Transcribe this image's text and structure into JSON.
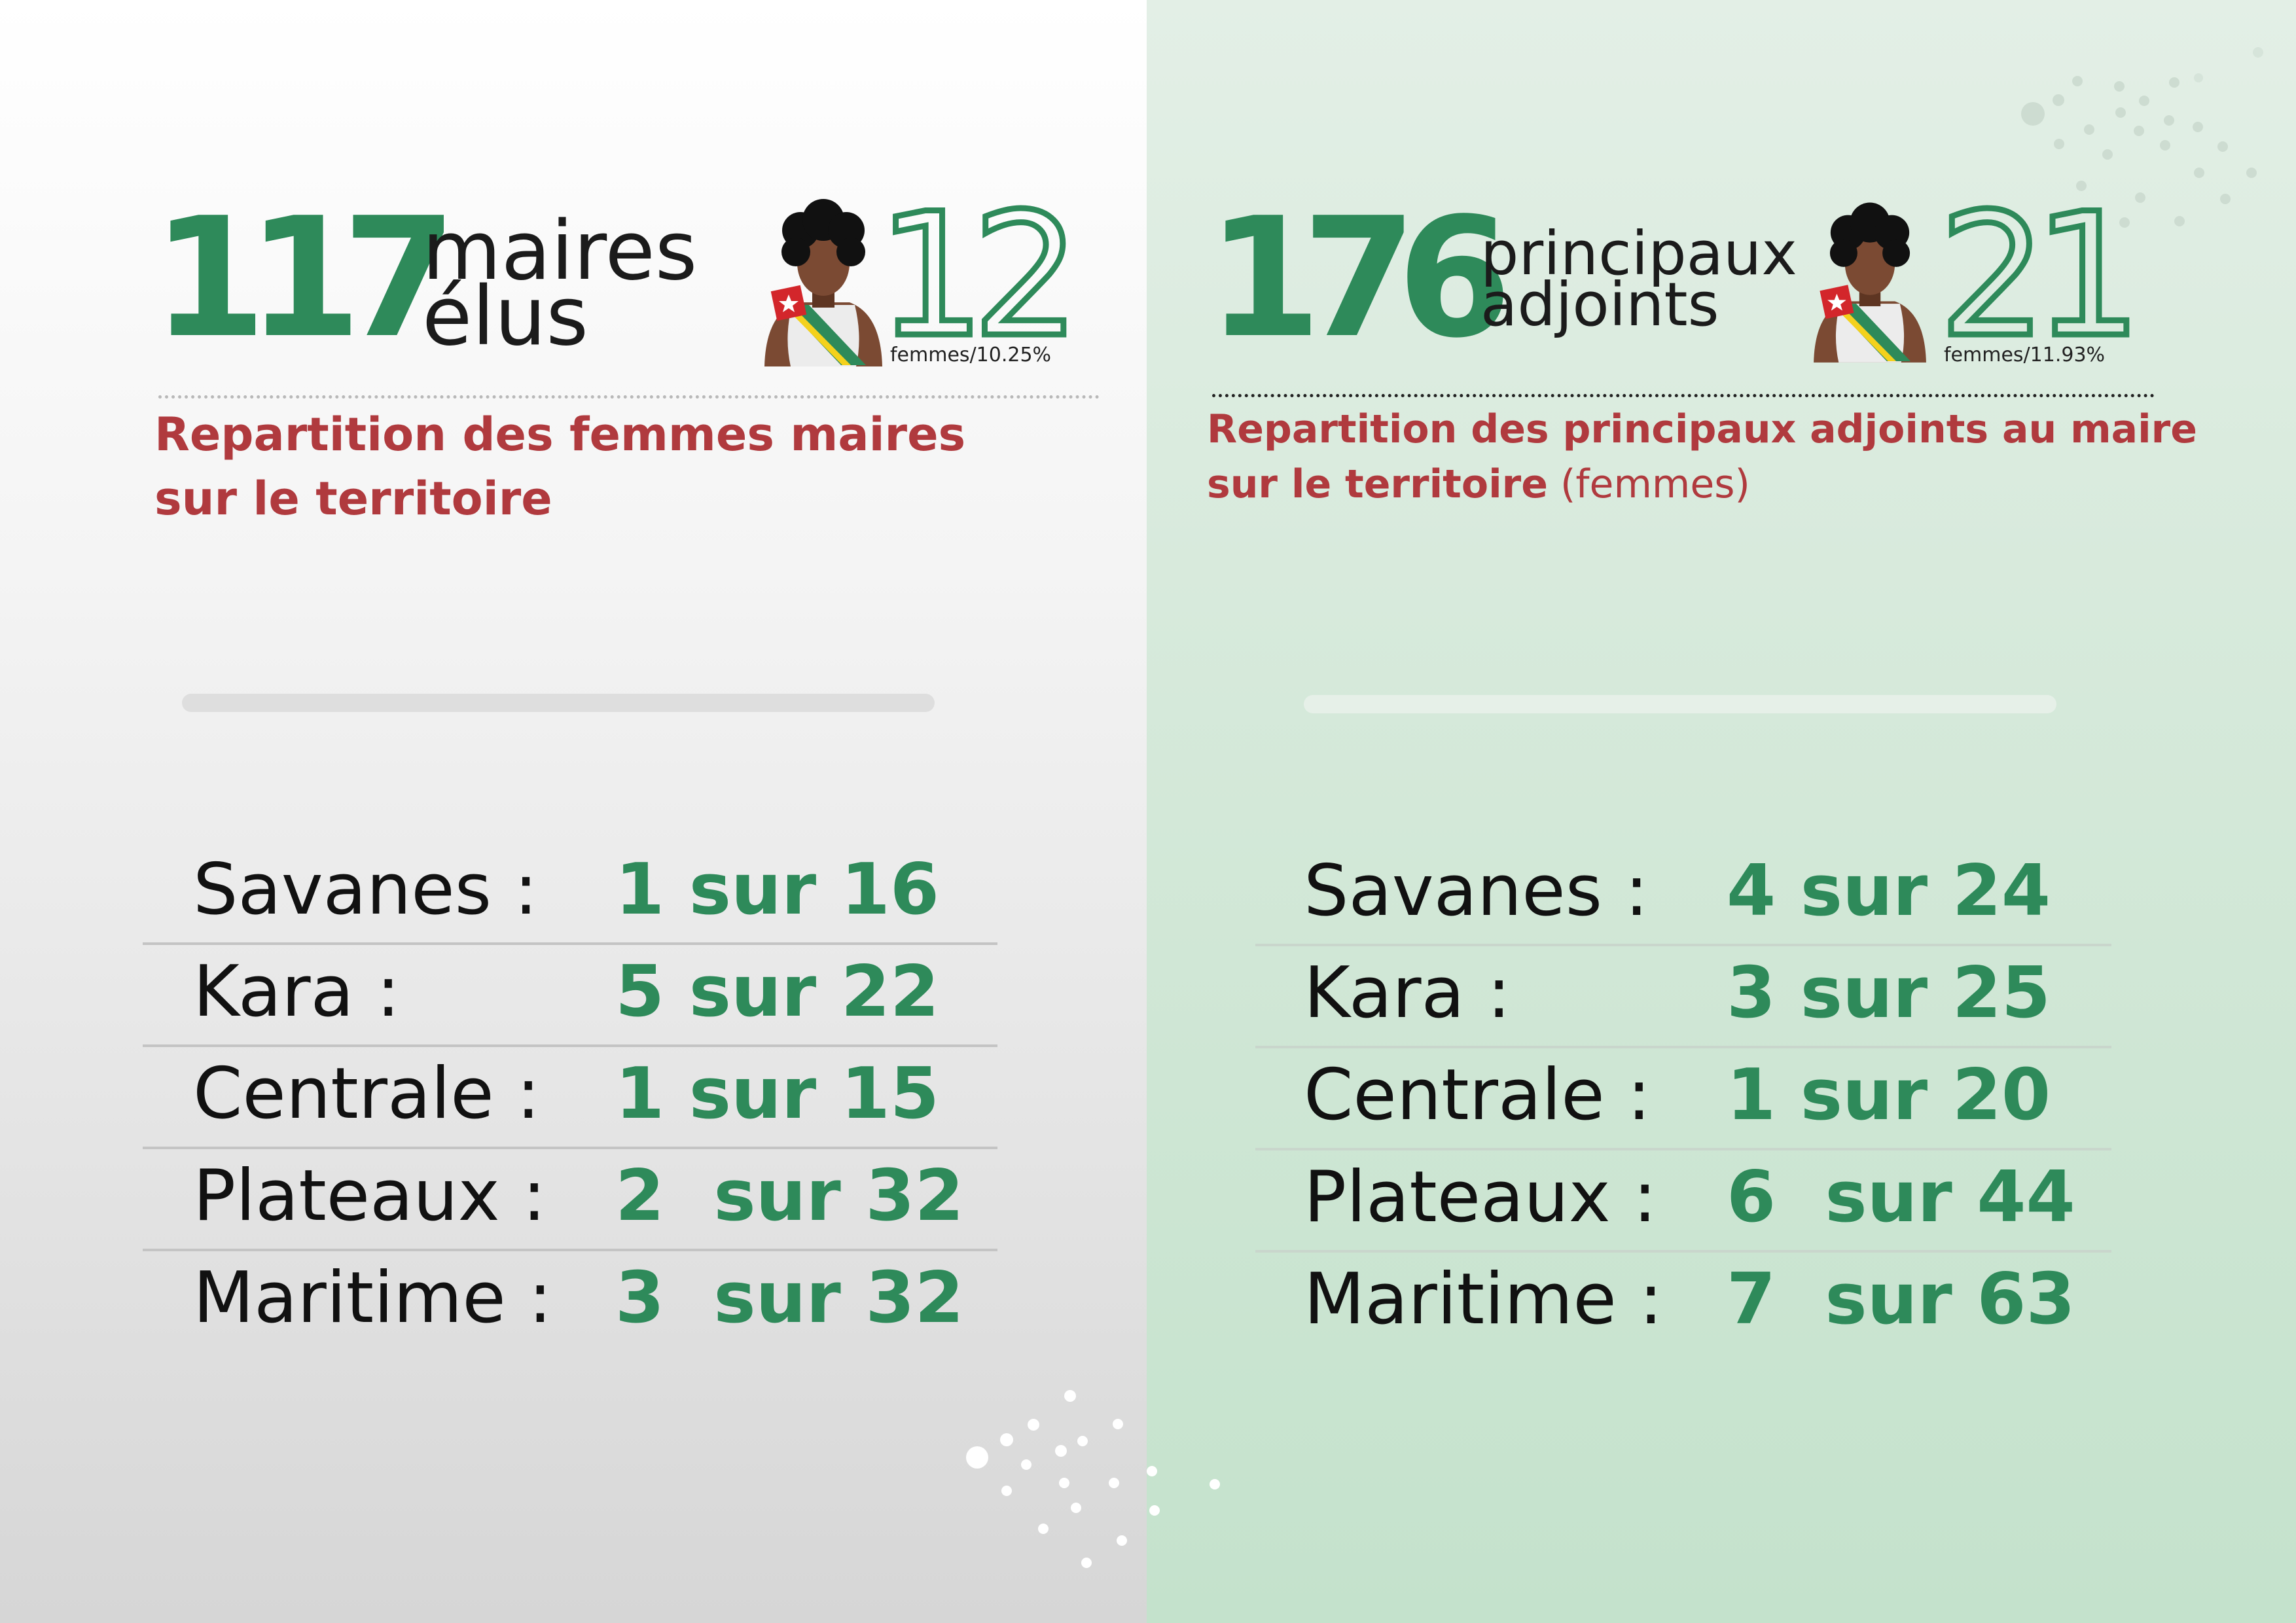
{
  "colors": {
    "green": "#2e8a5a",
    "red": "#b03a3e",
    "text": "#111111"
  },
  "left": {
    "big_number": "117",
    "label_line1": "maires",
    "label_line2": "élus",
    "icon": "woman-with-sash-icon",
    "women_count": "12",
    "women_pct": "femmes/10.25%",
    "subtitle_line1": "Repartition des femmes maires",
    "subtitle_line2": "sur le territoire",
    "rows": [
      {
        "region": "Savanes :",
        "value": "1 sur 16"
      },
      {
        "region": "Kara :",
        "value": "5 sur 22"
      },
      {
        "region": "Centrale :",
        "value": "1 sur 15"
      },
      {
        "region": "Plateaux :",
        "value": "2  sur 32"
      },
      {
        "region": "Maritime :",
        "value": "3  sur 32"
      }
    ]
  },
  "right": {
    "big_number": "176",
    "label_line1": "principaux",
    "label_line2": "adjoints",
    "icon": "woman-with-sash-icon",
    "women_count": "21",
    "women_pct": "femmes/11.93%",
    "subtitle_line1": "Repartition des  principaux adjoints au maire",
    "subtitle_line2_bold": "sur le territoire",
    "subtitle_line2_light": " (femmes)",
    "rows": [
      {
        "region": "Savanes :",
        "value": "4 sur 24"
      },
      {
        "region": "Kara :",
        "value": "3 sur 25"
      },
      {
        "region": "Centrale :",
        "value": "1 sur 20"
      },
      {
        "region": "Plateaux :",
        "value": "6  sur 44"
      },
      {
        "region": "Maritime :",
        "value": "7  sur 63"
      }
    ]
  }
}
